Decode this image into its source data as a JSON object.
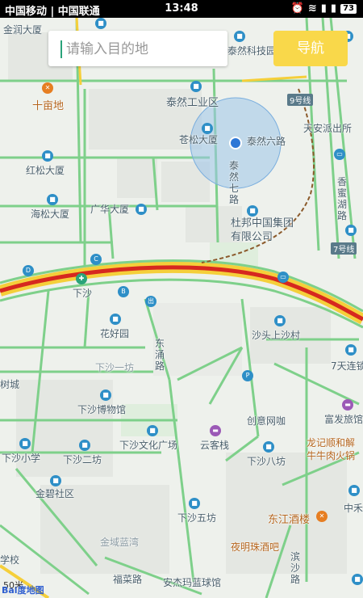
{
  "status": {
    "carriers": "中国移动 | 中国联通",
    "time": "13:48",
    "battery": "73"
  },
  "search": {
    "placeholder": "请输入目的地",
    "nav_label": "导航"
  },
  "map": {
    "labels": {
      "jinrun": "金润大厦",
      "tairanjiji": "泰然科技园",
      "shimudi": "十亩地",
      "tairangongye": "泰然工业区",
      "jiuhaoxian": "9号线",
      "tiananpaichu": "天安派出所",
      "hongsong": "红松大厦",
      "cangsong": "苍松大厦",
      "tairanliu": "泰然六路",
      "tairanqi": "泰然七路",
      "xiangmi": "香蜜湖路",
      "haisong": "海松大厦",
      "guanghua": "广华大厦",
      "dubang": "杜邦中国集团有限公司",
      "qihaoxian": "7号线",
      "xiasha": "下沙",
      "huahaoyuan": "花好园",
      "dongyong": "东涌路",
      "shatou": "沙头上沙村",
      "xiashayifang": "下沙一坊",
      "tianlian": "7天连锁",
      "shucheng": "树城",
      "bowuguan": "下沙博物馆",
      "chuangjie": "创意网咖",
      "fufa": "富发旅馆",
      "wenhua": "下沙文化广场",
      "yunkezhan": "云客栈",
      "longji": "龙记顺和解牛牛肉火锅",
      "xiaxue": "下沙小学",
      "erfang": "下沙二坊",
      "bafang": "下沙八坊",
      "jinbi": "金碧社区",
      "wufang": "下沙五坊",
      "dongjiang": "东江酒楼",
      "zhonghe": "中禾",
      "jinyu": "金域蓝湾",
      "yeming": "夜明珠酒吧",
      "xuexiao": "学校",
      "futian": "福菜路",
      "anjie": "安杰玛蓝球馆",
      "bingjing": "滨沙路"
    },
    "scale": "50米",
    "logo": "Bai度地图"
  }
}
